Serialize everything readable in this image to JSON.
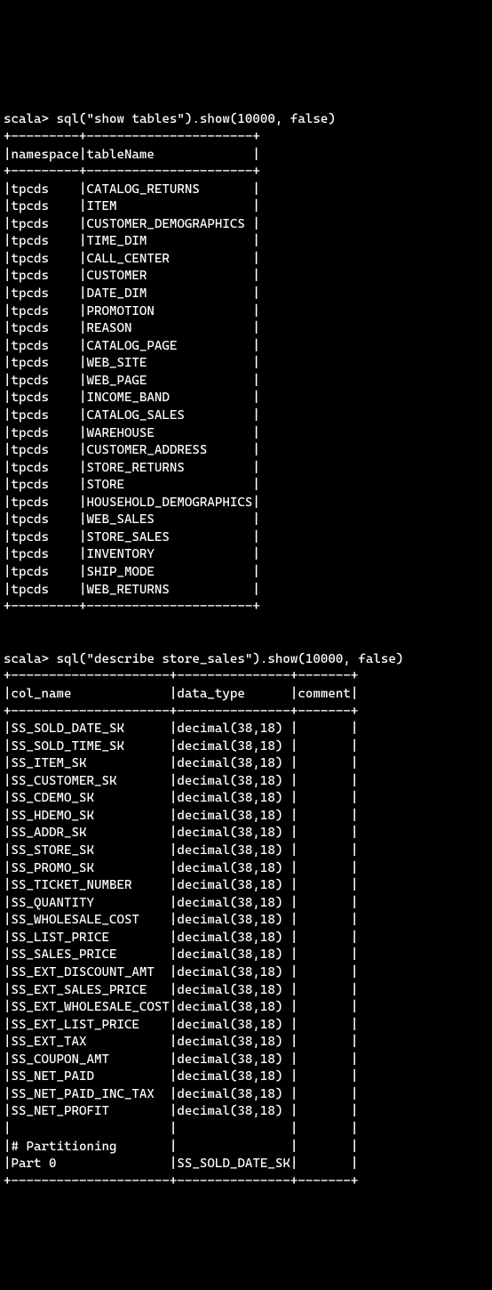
{
  "commands": {
    "first": {
      "prompt": "scala> ",
      "text": "sql(\"show tables\").show(10000, false)"
    },
    "second": {
      "prompt": "scala> ",
      "text": "sql(\"describe store_sales\").show(10000, false)"
    }
  },
  "tables_output": {
    "sep": "+---------+----------------------+",
    "header": "|namespace|tableName             |",
    "rows": [
      "|tpcds    |CATALOG_RETURNS       |",
      "|tpcds    |ITEM                  |",
      "|tpcds    |CUSTOMER_DEMOGRAPHICS |",
      "|tpcds    |TIME_DIM              |",
      "|tpcds    |CALL_CENTER           |",
      "|tpcds    |CUSTOMER              |",
      "|tpcds    |DATE_DIM              |",
      "|tpcds    |PROMOTION             |",
      "|tpcds    |REASON                |",
      "|tpcds    |CATALOG_PAGE          |",
      "|tpcds    |WEB_SITE              |",
      "|tpcds    |WEB_PAGE              |",
      "|tpcds    |INCOME_BAND           |",
      "|tpcds    |CATALOG_SALES         |",
      "|tpcds    |WAREHOUSE             |",
      "|tpcds    |CUSTOMER_ADDRESS      |",
      "|tpcds    |STORE_RETURNS         |",
      "|tpcds    |STORE                 |",
      "|tpcds    |HOUSEHOLD_DEMOGRAPHICS|",
      "|tpcds    |WEB_SALES             |",
      "|tpcds    |STORE_SALES           |",
      "|tpcds    |INVENTORY             |",
      "|tpcds    |SHIP_MODE             |",
      "|tpcds    |WEB_RETURNS           |"
    ]
  },
  "describe_output": {
    "sep": "+---------------------+---------------+-------+",
    "header": "|col_name             |data_type      |comment|",
    "rows": [
      "|SS_SOLD_DATE_SK      |decimal(38,18) |       |",
      "|SS_SOLD_TIME_SK      |decimal(38,18) |       |",
      "|SS_ITEM_SK           |decimal(38,18) |       |",
      "|SS_CUSTOMER_SK       |decimal(38,18) |       |",
      "|SS_CDEMO_SK          |decimal(38,18) |       |",
      "|SS_HDEMO_SK          |decimal(38,18) |       |",
      "|SS_ADDR_SK           |decimal(38,18) |       |",
      "|SS_STORE_SK          |decimal(38,18) |       |",
      "|SS_PROMO_SK          |decimal(38,18) |       |",
      "|SS_TICKET_NUMBER     |decimal(38,18) |       |",
      "|SS_QUANTITY          |decimal(38,18) |       |",
      "|SS_WHOLESALE_COST    |decimal(38,18) |       |",
      "|SS_LIST_PRICE        |decimal(38,18) |       |",
      "|SS_SALES_PRICE       |decimal(38,18) |       |",
      "|SS_EXT_DISCOUNT_AMT  |decimal(38,18) |       |",
      "|SS_EXT_SALES_PRICE   |decimal(38,18) |       |",
      "|SS_EXT_WHOLESALE_COST|decimal(38,18) |       |",
      "|SS_EXT_LIST_PRICE    |decimal(38,18) |       |",
      "|SS_EXT_TAX           |decimal(38,18) |       |",
      "|SS_COUPON_AMT        |decimal(38,18) |       |",
      "|SS_NET_PAID          |decimal(38,18) |       |",
      "|SS_NET_PAID_INC_TAX  |decimal(38,18) |       |",
      "|SS_NET_PROFIT        |decimal(38,18) |       |",
      "|                     |               |       |",
      "|# Partitioning       |               |       |",
      "|Part 0               |SS_SOLD_DATE_SK|       |"
    ]
  }
}
